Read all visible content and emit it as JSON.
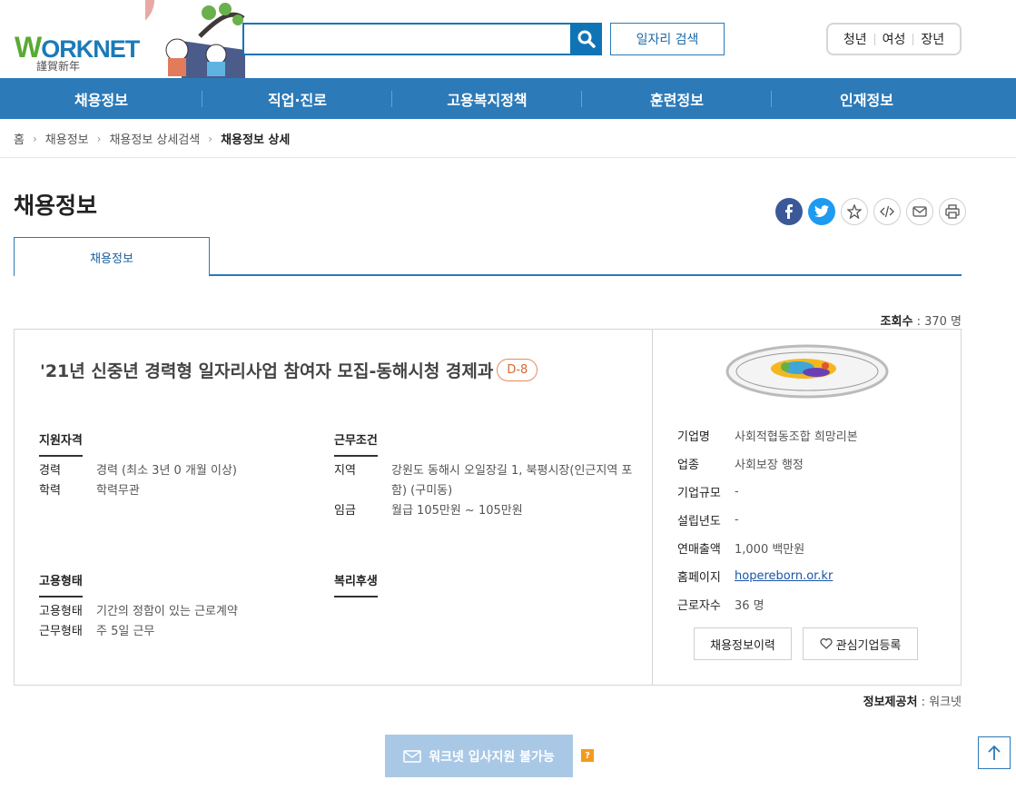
{
  "header": {
    "logo_text": "ORKNET",
    "logo_w": "W",
    "logo_sub": "謹賀新年",
    "search": {
      "value": "",
      "placeholder": ""
    },
    "job_search_label": "일자리 검색",
    "segments": [
      "청년",
      "여성",
      "장년"
    ]
  },
  "nav": [
    "채용정보",
    "직업·진로",
    "고용복지정책",
    "훈련정보",
    "인재정보"
  ],
  "breadcrumb": [
    "홈",
    "채용정보",
    "채용정보 상세검색",
    "채용정보 상세"
  ],
  "page_title": "채용정보",
  "tab_label": "채용정보",
  "views": {
    "label": "조회수",
    "value": ": 370 명"
  },
  "job": {
    "title": "'21년 신중년 경력형 일자리사업 참여자 모집-동해시청 경제과",
    "dday": "D-8",
    "qualifications": {
      "title": "지원자격",
      "rows": [
        {
          "k": "경력",
          "v": "경력 (최소 3년 0 개월 이상)"
        },
        {
          "k": "학력",
          "v": "학력무관"
        }
      ]
    },
    "conditions": {
      "title": "근무조건",
      "rows": [
        {
          "k": "지역",
          "v1": "강원도 동해시 오일장길 1, 북평시장(인근지역 포",
          "v2": "함) (구미동)"
        },
        {
          "k": "임금",
          "v": "월급 105만원 ~ 105만원"
        }
      ]
    },
    "employment": {
      "title": "고용형태",
      "rows": [
        {
          "k": "고용형태",
          "v": "기간의 정함이 있는 근로계약"
        },
        {
          "k": "근무형태",
          "v": "주 5일 근무"
        }
      ]
    },
    "welfare": {
      "title": "복리후생"
    }
  },
  "company": {
    "rows": [
      {
        "k": "기업명",
        "v": "사회적협동조합 희망리본"
      },
      {
        "k": "업종",
        "v": "사회보장 행정"
      },
      {
        "k": "기업규모",
        "v": "-"
      },
      {
        "k": "설립년도",
        "v": "-"
      },
      {
        "k": "연매출액",
        "v": "1,000 백만원"
      },
      {
        "k": "홈페이지",
        "v": "hopereborn.or.kr"
      },
      {
        "k": "근로자수",
        "v": "36 명"
      }
    ],
    "history_btn": "채용정보이력",
    "favorite_btn": "관심기업등록"
  },
  "source": {
    "label": "정보제공처",
    "value": ": 워크넷"
  },
  "apply_btn": "워크넷 입사지원 불가능",
  "help_label": "?",
  "colors": {
    "nav": "#2c7ab8",
    "accent": "#0f74b5",
    "dday": "#d9682e",
    "apply": "#a9c8e6"
  }
}
